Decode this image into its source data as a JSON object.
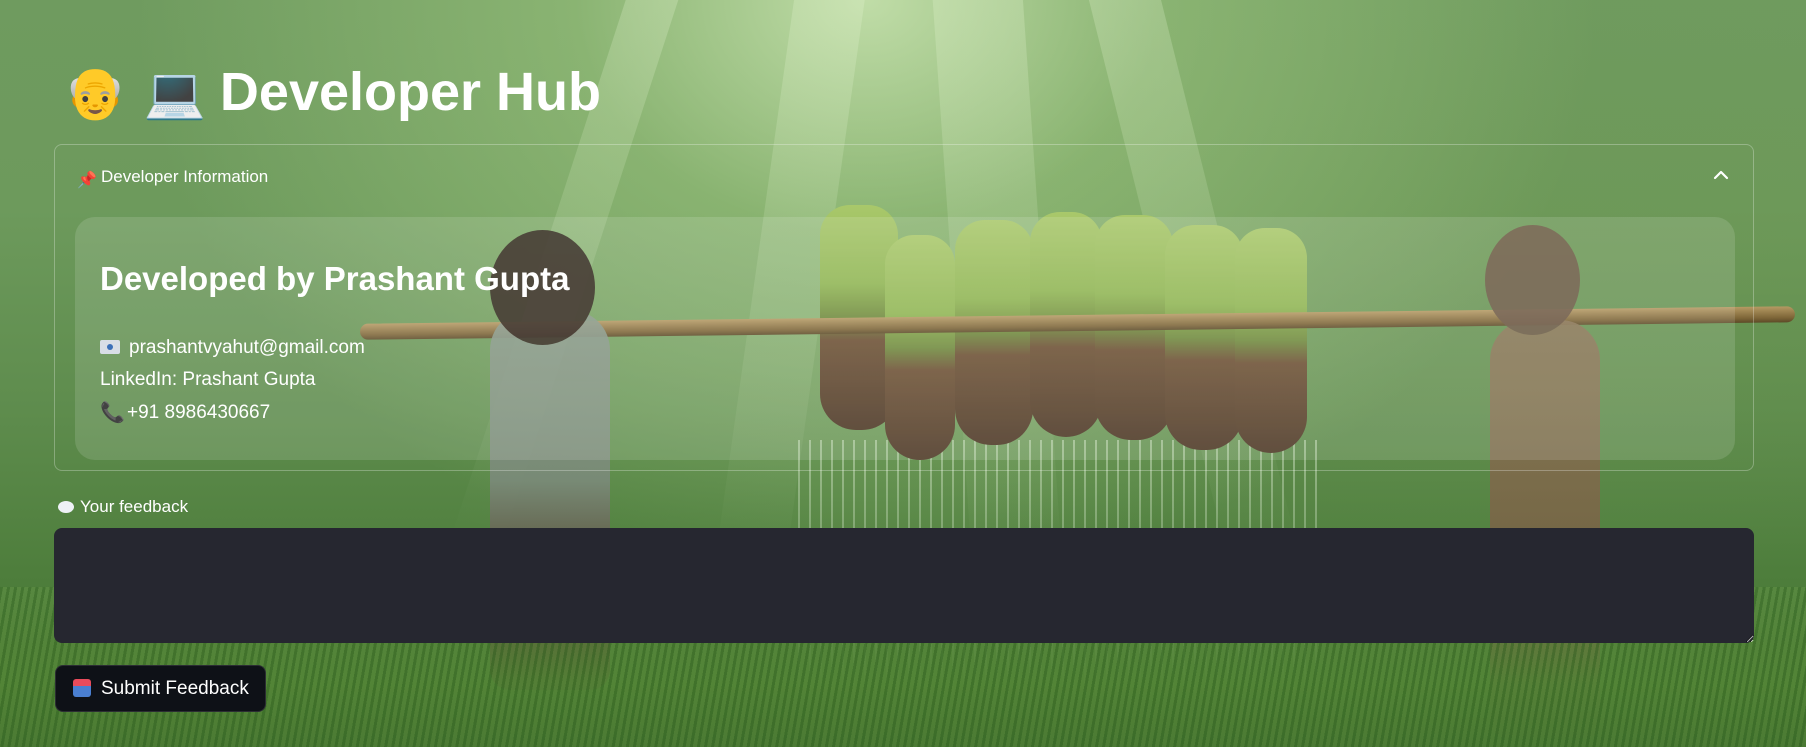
{
  "header": {
    "emoji": "👴 💻",
    "title": "Developer Hub"
  },
  "developer_info": {
    "expander_label": "Developer Information",
    "expanded": true,
    "heading": "Developed by Prashant Gupta",
    "email": "prashantvyahut@gmail.com",
    "linkedin": "LinkedIn: Prashant Gupta",
    "phone": "+91 8986430667"
  },
  "feedback": {
    "label": "Your feedback",
    "value": "",
    "submit_label": "Submit Feedback"
  },
  "icons": {
    "pin": "pushpin-icon",
    "chevron": "chevron-up-icon",
    "email": "envelope-icon",
    "phone": "telephone-icon",
    "feedback": "speech-bubble-icon",
    "submit": "mailbox-icon"
  },
  "colors": {
    "input_background": "#262730",
    "button_background": "#0e1117",
    "text": "#ffffff"
  }
}
